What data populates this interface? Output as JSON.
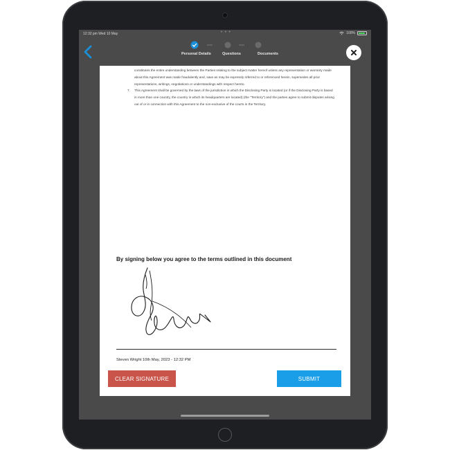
{
  "status_bar": {
    "time_date": "12:32 pm   Wed 10 May",
    "battery_text": "100%"
  },
  "stepper": {
    "steps": [
      {
        "label": "Personal Details"
      },
      {
        "label": "Questions"
      },
      {
        "label": "Documents"
      }
    ],
    "completed_steps": 1,
    "back_icon": "chevron-left-icon"
  },
  "modal": {
    "close_icon": "close-icon",
    "document": {
      "clause_6_tail": "constitutes the entire understanding between the Parties relating to the subject matter hereof unless any representation or warranty made about this Agreement was made fraudulently and, save as may be expressly referred to or referenced herein, supersedes all prior representations, writings, negotiations or understandings with respect hereto.",
      "clause_7_number": "7.",
      "clause_7_text": "This Agreement shall be governed by the laws of the jurisdiction in which the Disclosing Party is located (or if the Disclosing Party is based in more than one country, the country in which its headquarters are located) (the \"Territory\") and the parties agree to submit disputes arising out of or in connection with this Agreement to the non-exclusive of the courts in the Territory."
    },
    "sign_heading": "By signing below you agree to the terms outlined in this document",
    "signature_meta": "Steven Wright 10th May, 2023 - 12:32 PM",
    "clear_button": "CLEAR SIGNATURE",
    "submit_button": "SUBMIT"
  },
  "colors": {
    "clear": "#c9544a",
    "submit": "#1a9ee8",
    "step_active": "#1a8fd6",
    "back": "#1a8fd6"
  }
}
